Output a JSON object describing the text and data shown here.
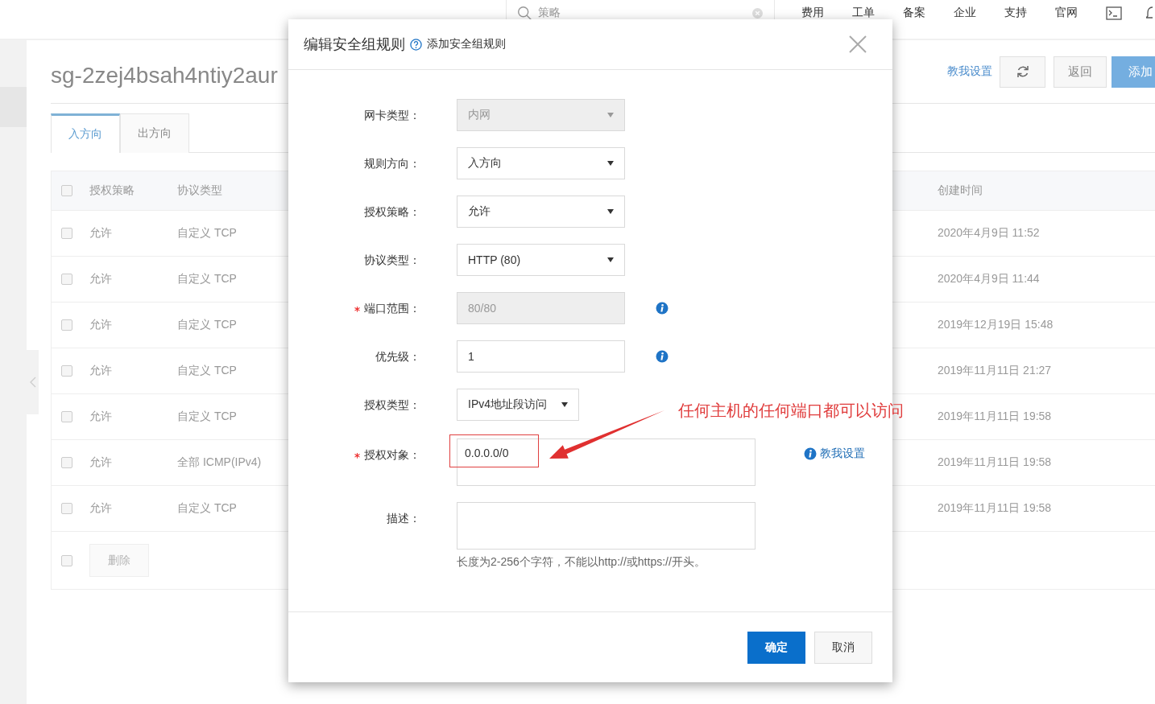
{
  "top_bar": {
    "search": {
      "placeholder": "策略"
    },
    "nav": [
      "费用",
      "工单",
      "备案",
      "企业",
      "支持",
      "官网"
    ]
  },
  "page": {
    "title": "sg-2zej4bsah4ntiy2aur",
    "help_link": "教我设置",
    "back_button": "返回",
    "add_button": "添加",
    "tabs": [
      {
        "label": "入方向",
        "selected": true
      },
      {
        "label": "出方向",
        "selected": false
      }
    ],
    "table": {
      "select_all_checked": false,
      "columns": [
        "授权策略",
        "协议类型",
        "创建时间"
      ],
      "rows": [
        {
          "checked": false,
          "policy": "允许",
          "protocol": "自定义 TCP",
          "created": "2020年4月9日 11:52"
        },
        {
          "checked": false,
          "policy": "允许",
          "protocol": "自定义 TCP",
          "created": "2020年4月9日 11:44"
        },
        {
          "checked": false,
          "policy": "允许",
          "protocol": "自定义 TCP",
          "created": "2019年12月19日 15:48"
        },
        {
          "checked": false,
          "policy": "允许",
          "protocol": "自定义 TCP",
          "created": "2019年11月11日 21:27"
        },
        {
          "checked": false,
          "policy": "允许",
          "protocol": "自定义 TCP",
          "created": "2019年11月11日 19:58"
        },
        {
          "checked": false,
          "policy": "允许",
          "protocol": "全部 ICMP(IPv4)",
          "created": "2019年11月11日 19:58"
        },
        {
          "checked": false,
          "policy": "允许",
          "protocol": "自定义 TCP",
          "created": "2019年11月11日 19:58"
        }
      ],
      "footer_checked": false,
      "delete_button": {
        "label": "删除",
        "disabled": true
      }
    }
  },
  "dialog": {
    "title": "编辑安全组规则",
    "help_link": "添加安全组规则",
    "fields": [
      {
        "kind": "select",
        "label": "网卡类型：",
        "required": false,
        "value": "内网",
        "disabled": true
      },
      {
        "kind": "select",
        "label": "规则方向：",
        "required": false,
        "value": "入方向",
        "disabled": false
      },
      {
        "kind": "select",
        "label": "授权策略：",
        "required": false,
        "value": "允许",
        "disabled": false
      },
      {
        "kind": "select",
        "label": "协议类型：",
        "required": false,
        "value": "HTTP (80)",
        "disabled": false
      },
      {
        "kind": "input",
        "label": "端口范围：",
        "required": true,
        "value": "80/80",
        "disabled": true,
        "info": true
      },
      {
        "kind": "input",
        "label": "优先级：",
        "required": false,
        "value": "1",
        "disabled": false,
        "info": true
      },
      {
        "kind": "compact-select",
        "label": "授权类型：",
        "required": false,
        "value": "IPv4地址段访问",
        "disabled": false
      },
      {
        "kind": "textarea",
        "label": "授权对象：",
        "required": true,
        "value": "0.0.0.0/0",
        "disabled": false,
        "link": "教我设置"
      },
      {
        "kind": "textarea",
        "label": "描述：",
        "required": false,
        "disabled": false,
        "hint": "长度为2-256个字符，不能以http://或https://开头。"
      }
    ],
    "annotation": {
      "text": "任何主机的任何端口都可以访问"
    },
    "buttons": [
      {
        "kind": "primary",
        "label": "确定"
      },
      {
        "kind": "default",
        "label": "取消"
      }
    ]
  }
}
